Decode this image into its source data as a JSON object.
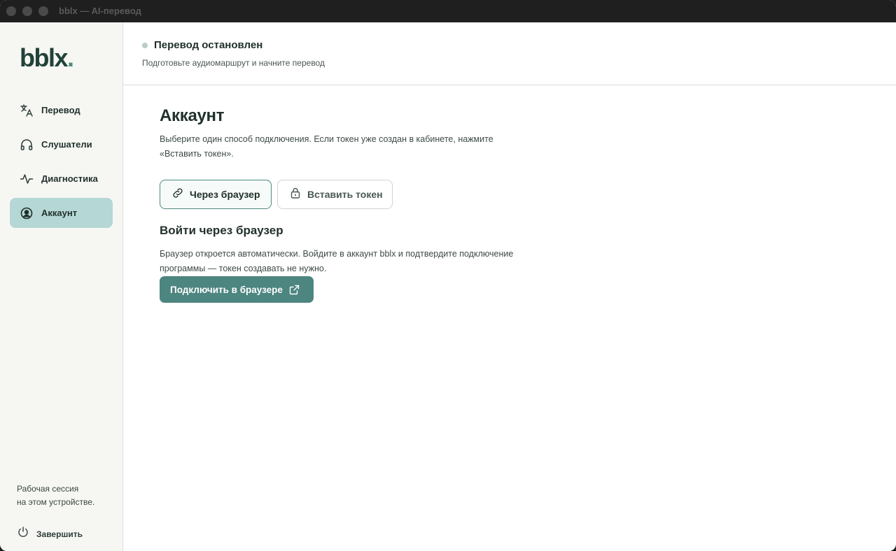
{
  "window": {
    "title": "bblx — AI-перевод"
  },
  "sidebar": {
    "logo": "bblx",
    "logo_dot": ".",
    "items": [
      {
        "label": "Перевод",
        "icon": "translate-icon",
        "active": false
      },
      {
        "label": "Слушатели",
        "icon": "headphones-icon",
        "active": false
      },
      {
        "label": "Диагностика",
        "icon": "activity-icon",
        "active": false
      },
      {
        "label": "Аккаунт",
        "icon": "account-icon",
        "active": true
      }
    ],
    "session_line1": "Рабочая сессия",
    "session_line2": "на этом устройстве.",
    "logout_label": "Завершить"
  },
  "header": {
    "status_title": "Перевод остановлен",
    "status_sub": "Подготовьте аудиомаршрут и начните перевод"
  },
  "main": {
    "title": "Аккаунт",
    "description": "Выберите один способ подключения. Если токен уже создан в кабинете, нажмите «Вставить токен».",
    "options": [
      {
        "label": "Через браузер",
        "icon": "link-icon",
        "selected": true
      },
      {
        "label": "Вставить токен",
        "icon": "lock-icon",
        "selected": false
      }
    ],
    "section_title": "Войти через браузер",
    "section_desc": "Браузер откроется автоматически. Войдите в аккаунт bblx и подтвердите подключение программы — токен создавать не нужно.",
    "cta_label": "Подключить в браузере"
  },
  "colors": {
    "accent": "#4d8580",
    "active_nav": "#b5d7d5",
    "text": "#22312d"
  }
}
